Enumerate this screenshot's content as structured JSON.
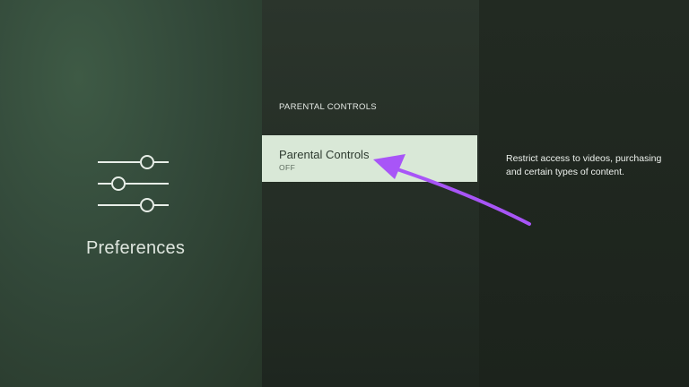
{
  "sidebar": {
    "icon": "sliders-icon",
    "title": "Preferences"
  },
  "menu": {
    "header": "PARENTAL CONTROLS",
    "items": [
      {
        "label": "Parental Controls",
        "value": "OFF",
        "selected": true
      }
    ]
  },
  "detail": {
    "description": "Restrict access to videos, purchasing and certain types of content."
  },
  "annotation": {
    "type": "arrow",
    "color": "#a855f7"
  },
  "colors": {
    "selected_bg": "#d9e8d7",
    "text_light": "#eef2ee"
  }
}
